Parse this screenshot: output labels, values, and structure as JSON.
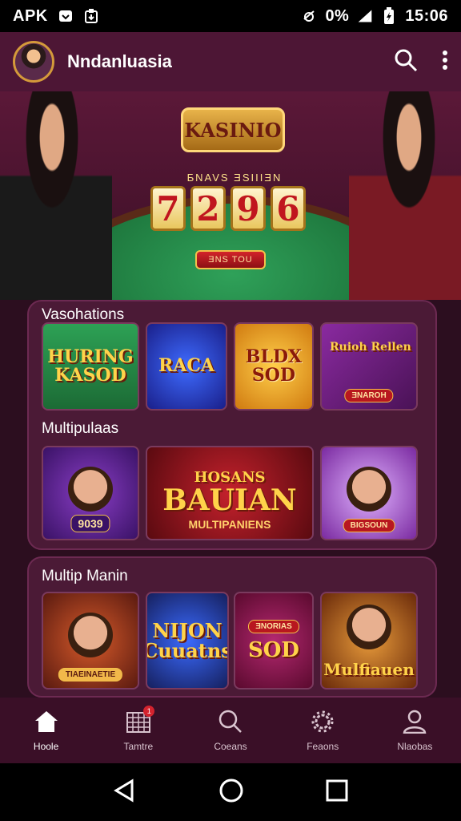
{
  "status_bar": {
    "left_text": "APK",
    "battery_text": "0%",
    "time": "15:06"
  },
  "app_bar": {
    "title": "Nndanluasia"
  },
  "hero": {
    "logo_text": "KASINIO",
    "subtitle": "ƂNAVS ƎSIIIƎN",
    "digits": [
      "7",
      "2",
      "9",
      "6"
    ],
    "cta_label": "ƎNS TOU"
  },
  "sections": [
    {
      "label": "Vasohations",
      "tiles": [
        {
          "main": "HURING KASOD",
          "bg": "#1c7a3c",
          "sub": ""
        },
        {
          "main": "RACA",
          "bg": "#2a3ad6",
          "sub": ""
        },
        {
          "main": "BLDX SOD",
          "bg": "#f1a21c",
          "sub": ""
        },
        {
          "main": "Ruioh Rellen",
          "bg": "#6a1d7e",
          "sub": "ƎNAROH"
        }
      ]
    },
    {
      "label": "Multipulaas",
      "tiles": [
        {
          "main": "",
          "bg": "#5b1e82",
          "sub": "9039"
        },
        {
          "main": "BAUIAN",
          "bg": "#8a1018",
          "sub": "MULTIPANIENS",
          "top": "HOSANS"
        },
        {
          "main": "",
          "bg": "#b06bd1",
          "sub": "BIGSOUN"
        }
      ]
    },
    {
      "label": "Multip Manin",
      "tiles": [
        {
          "main": "",
          "bg": "#8a2e1a",
          "sub": "TIAEINAETIE"
        },
        {
          "main": "NIJON Cuuatns",
          "bg": "#1f3d9e",
          "sub": ""
        },
        {
          "main": "SOD",
          "bg": "#7a1744",
          "sub": "ƎNORIAS"
        },
        {
          "main": "Mulfiauen",
          "bg": "#a8561a",
          "sub": ""
        }
      ]
    }
  ],
  "bottom_nav": [
    {
      "label": "Hoole",
      "icon": "home-icon"
    },
    {
      "label": "Tamtre",
      "icon": "calendar-icon",
      "badge": "1"
    },
    {
      "label": "Coeans",
      "icon": "search-icon"
    },
    {
      "label": "Feaons",
      "icon": "gear-icon"
    },
    {
      "label": "Nlaobas",
      "icon": "profile-icon"
    }
  ]
}
